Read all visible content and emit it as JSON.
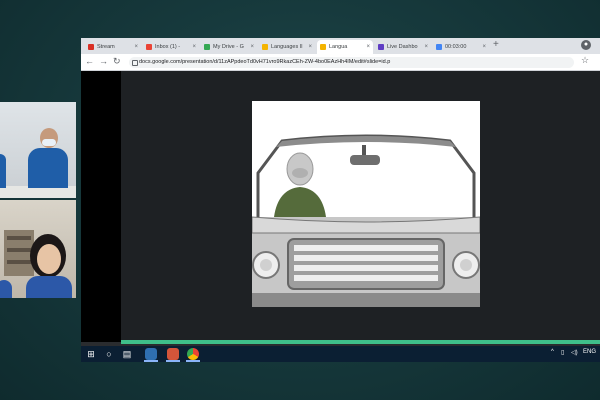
{
  "browser": {
    "tabs": [
      {
        "label": "Stream",
        "color": "#d93025"
      },
      {
        "label": "Inbox (1) - ",
        "color": "#ea4335"
      },
      {
        "label": "My Drive - G",
        "color": "#34a853"
      },
      {
        "label": "Languages Il",
        "color": "#f4b400"
      },
      {
        "label": "Langua",
        "color": "#f4b400",
        "active": true
      },
      {
        "label": "Live Dashbo",
        "color": "#5f3dc4"
      },
      {
        "label": "00:03:00",
        "color": "#4285f4"
      }
    ],
    "new_tab": "+",
    "url": "docs.google.com/presentation/d/11zAPpdeoTd0vH71vro9RkazCEh-ZW-4bo0EAzHh4IM/edit#slide=id.p"
  },
  "slide": {
    "illustration": "car-with-driver",
    "colors": {
      "body": "#c7c7c7",
      "outline": "#555555",
      "sky": "#ffffff",
      "driver": "#556b3b"
    }
  },
  "taskbar": {
    "apps": [
      "start-icon",
      "search-icon",
      "task-view-icon",
      "file-explorer-icon",
      "media-app-icon",
      "chrome-icon"
    ],
    "tray_language": "ENG"
  },
  "colors": {
    "background": "#173a3d",
    "progress": "#3fbf8a",
    "taskbar": "#0b1f33"
  }
}
